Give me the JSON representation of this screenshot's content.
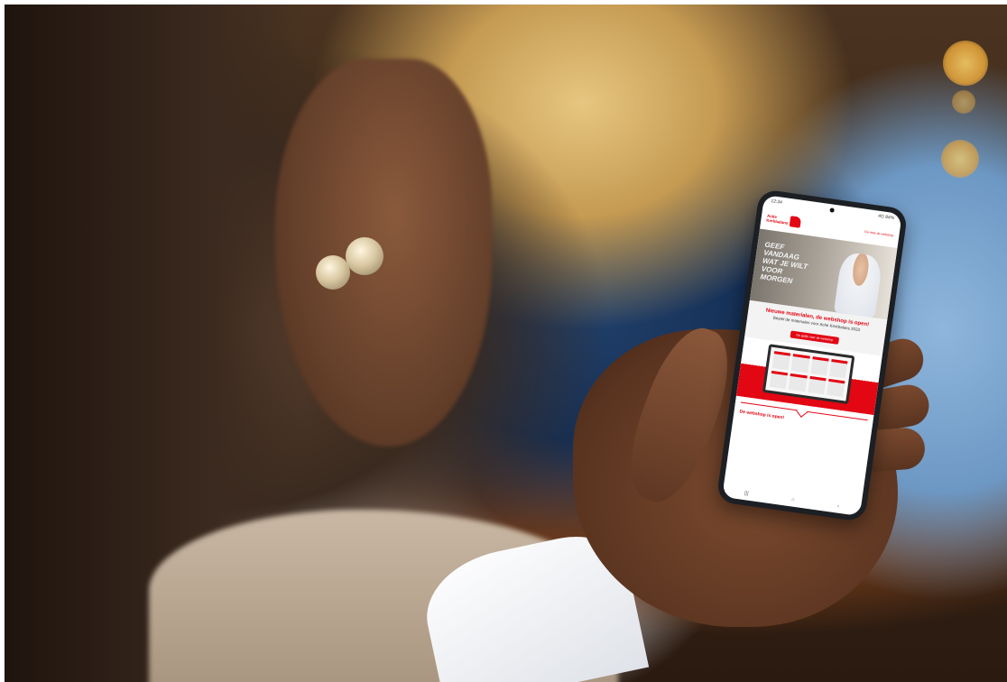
{
  "phone": {
    "status_time": "12:34",
    "status_icons": "4G 84%",
    "header_link": "Ga naar de webshop",
    "logo_line1": "Actie",
    "logo_line2": "Kerkbalans",
    "hero_text": "GEEF VANDAAG WAT JE WILT VOOR MORGEN",
    "promo_title": "Nieuwe materialen, de webshop is open!",
    "promo_subtitle": "Bestel de materialen voor Actie Kerkbalans 2023",
    "promo_button": "Ga gelijk naar de webshop",
    "section_title": "De webshop is open!",
    "nav_recent": "|||",
    "nav_home": "○",
    "nav_back": "‹"
  },
  "colors": {
    "brand_red": "#e30613"
  }
}
